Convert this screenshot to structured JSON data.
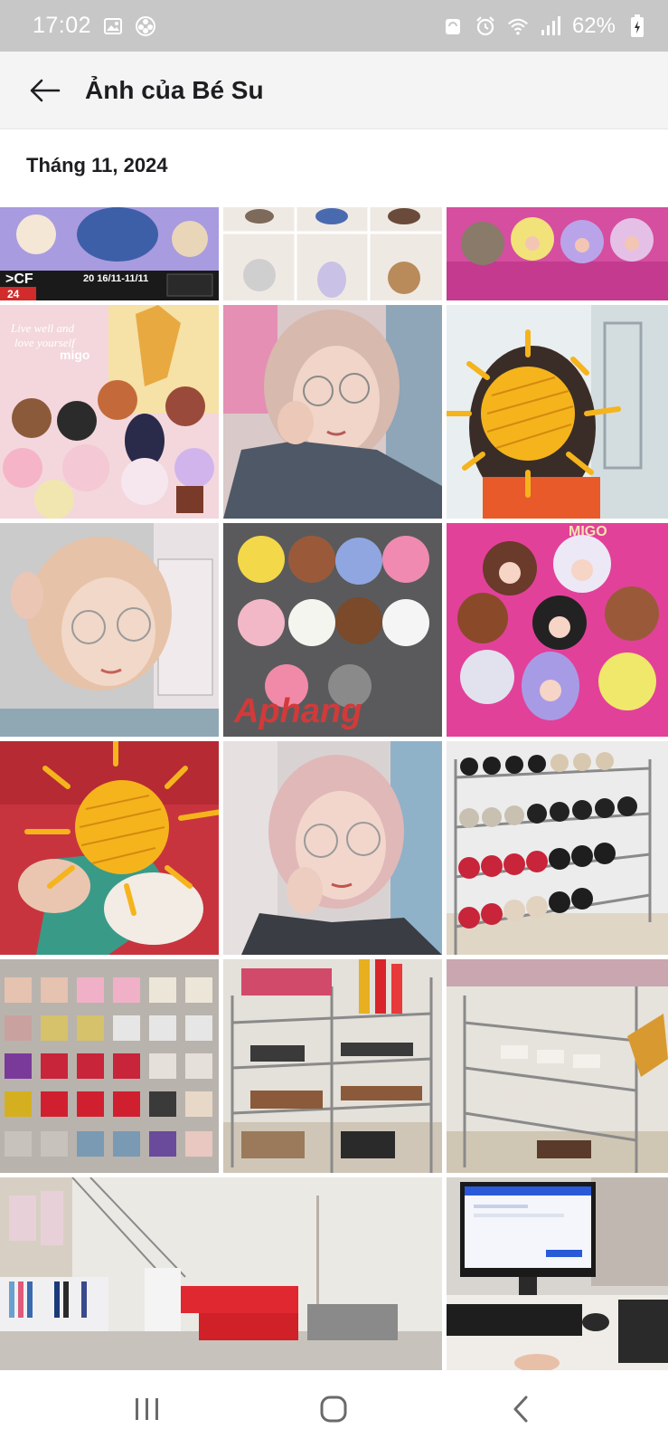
{
  "status_bar": {
    "time": "17:02",
    "battery": "62%",
    "left_icons": [
      "gallery-icon",
      "flower-icon"
    ],
    "right_icons": [
      "sync-icon",
      "alarm-icon",
      "wifi-icon",
      "signal-icon",
      "battery-icon"
    ]
  },
  "header": {
    "title": "Ảnh của Bé Su",
    "back_icon": "arrow-left-icon"
  },
  "section": {
    "title": "Tháng 11, 2024"
  },
  "photos": [
    {
      "name": "photo-doll-promo-banner",
      "subject": "doll event banner"
    },
    {
      "name": "photo-keychain-grid",
      "subject": "keychain toys"
    },
    {
      "name": "photo-dolls-pink-box",
      "subject": "plush dolls in box"
    },
    {
      "name": "photo-migo-doll-display",
      "subject": "doll display"
    },
    {
      "name": "photo-selfie-glasses-1",
      "subject": "selfie"
    },
    {
      "name": "photo-sun-sticker-child",
      "subject": "child with sun sticker"
    },
    {
      "name": "photo-selfie-glasses-2",
      "subject": "selfie"
    },
    {
      "name": "photo-aphang-dolls",
      "subject": "plush dolls"
    },
    {
      "name": "photo-migo-dolls-pink",
      "subject": "plush dolls"
    },
    {
      "name": "photo-sun-sticker-baby",
      "subject": "baby with sun sticker"
    },
    {
      "name": "photo-selfie-glasses-3",
      "subject": "selfie"
    },
    {
      "name": "photo-shelf-caps",
      "subject": "shelf of caps"
    },
    {
      "name": "photo-underwear-rack",
      "subject": "underwear display"
    },
    {
      "name": "photo-store-shelves-1",
      "subject": "store shelves"
    },
    {
      "name": "photo-store-shelves-2",
      "subject": "store shelves"
    },
    {
      "name": "photo-store-interior",
      "subject": "store interior"
    },
    {
      "name": "photo-computer-desk",
      "subject": "computer at counter"
    }
  ],
  "overlay_text": {
    "banner_brand": ">CF",
    "banner_date": "20 16/11-11/11",
    "banner_day": "24",
    "doll_display_caption_1": "Live well and",
    "doll_display_caption_2": "love yourself",
    "doll_display_caption_3": "migo",
    "aphang_watermark": "Aphang",
    "migo_sign": "MIGO"
  },
  "nav": {
    "recent_icon": "recent-apps-icon",
    "home_icon": "home-icon",
    "back_icon": "nav-back-icon"
  },
  "colors": {
    "status_bar": "#c7c7c7",
    "header_bg": "#f4f4f4",
    "sticker_sun": "#f5b41c"
  }
}
